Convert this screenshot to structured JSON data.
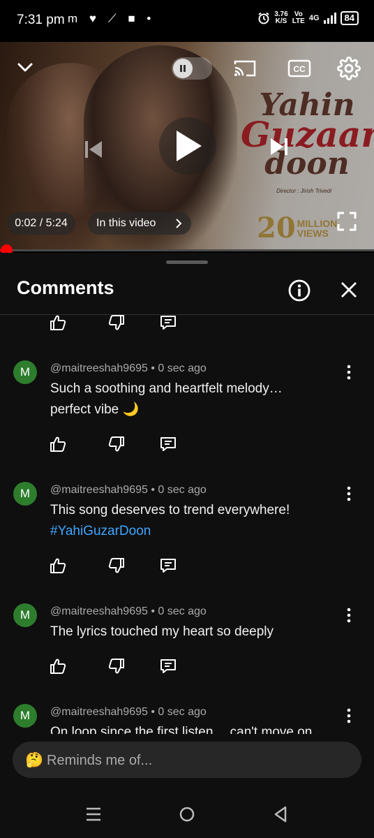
{
  "status_bar": {
    "time": "7:31 pm",
    "left_icons": "m ♥ ⟋ ■ •",
    "net_speed_value": "3.76",
    "net_speed_unit": "K/S",
    "volte_top": "Vo",
    "volte_bottom": "LTE",
    "network": "4G",
    "battery": "84"
  },
  "video": {
    "art_title_line1": "Yahin",
    "art_title_line2": "Guzaar",
    "art_title_line3": "doon",
    "art_director": "Director : Jirish Trivedi",
    "art_views_number": "20",
    "art_views_word1": "MILLION",
    "art_views_word2": "VIEWS",
    "time_label": "0:02 / 5:24",
    "in_this_video_label": "In this video",
    "progress_fraction": 0.006
  },
  "comments_panel": {
    "title": "Comments",
    "composer_emoji": "🤔",
    "composer_placeholder": "Reminds me of..."
  },
  "comments": [
    {
      "avatar": "M",
      "handle": "@maitreeshah9695",
      "time": "0 sec ago",
      "text_line1": "Such a soothing and heartfelt melody…",
      "text_line2": "perfect vibe 🌙"
    },
    {
      "avatar": "M",
      "handle": "@maitreeshah9695",
      "time": "0 sec ago",
      "text_line1": "This song deserves to trend everywhere!",
      "text_line2": "#YahiGuzarDoon"
    },
    {
      "avatar": "M",
      "handle": "@maitreeshah9695",
      "time": "0 sec ago",
      "text_line1": "The lyrics touched my heart so deeply",
      "text_line2": ""
    },
    {
      "avatar": "M",
      "handle": "@maitreeshah9695",
      "time": "0 sec ago",
      "text_line1": "On loop since the first listen… can't move on",
      "text_line2": ""
    }
  ],
  "icons": {
    "collapse": "chevron-down-icon",
    "pause": "pause-icon",
    "cast": "cast-icon",
    "captions": "cc-icon",
    "settings": "gear-icon",
    "previous": "previous-icon",
    "play": "play-icon",
    "next": "next-icon",
    "fullscreen": "fullscreen-icon",
    "info": "info-icon",
    "close": "close-icon",
    "like": "thumbs-up-icon",
    "dislike": "thumbs-down-icon",
    "reply": "reply-icon",
    "more": "more-vert-icon"
  },
  "colors": {
    "accent_red": "#ff0000",
    "avatar_green": "#2d7d2d",
    "hashtag_blue": "#3ea6ff",
    "sheet_bg": "#0f0f0f"
  }
}
